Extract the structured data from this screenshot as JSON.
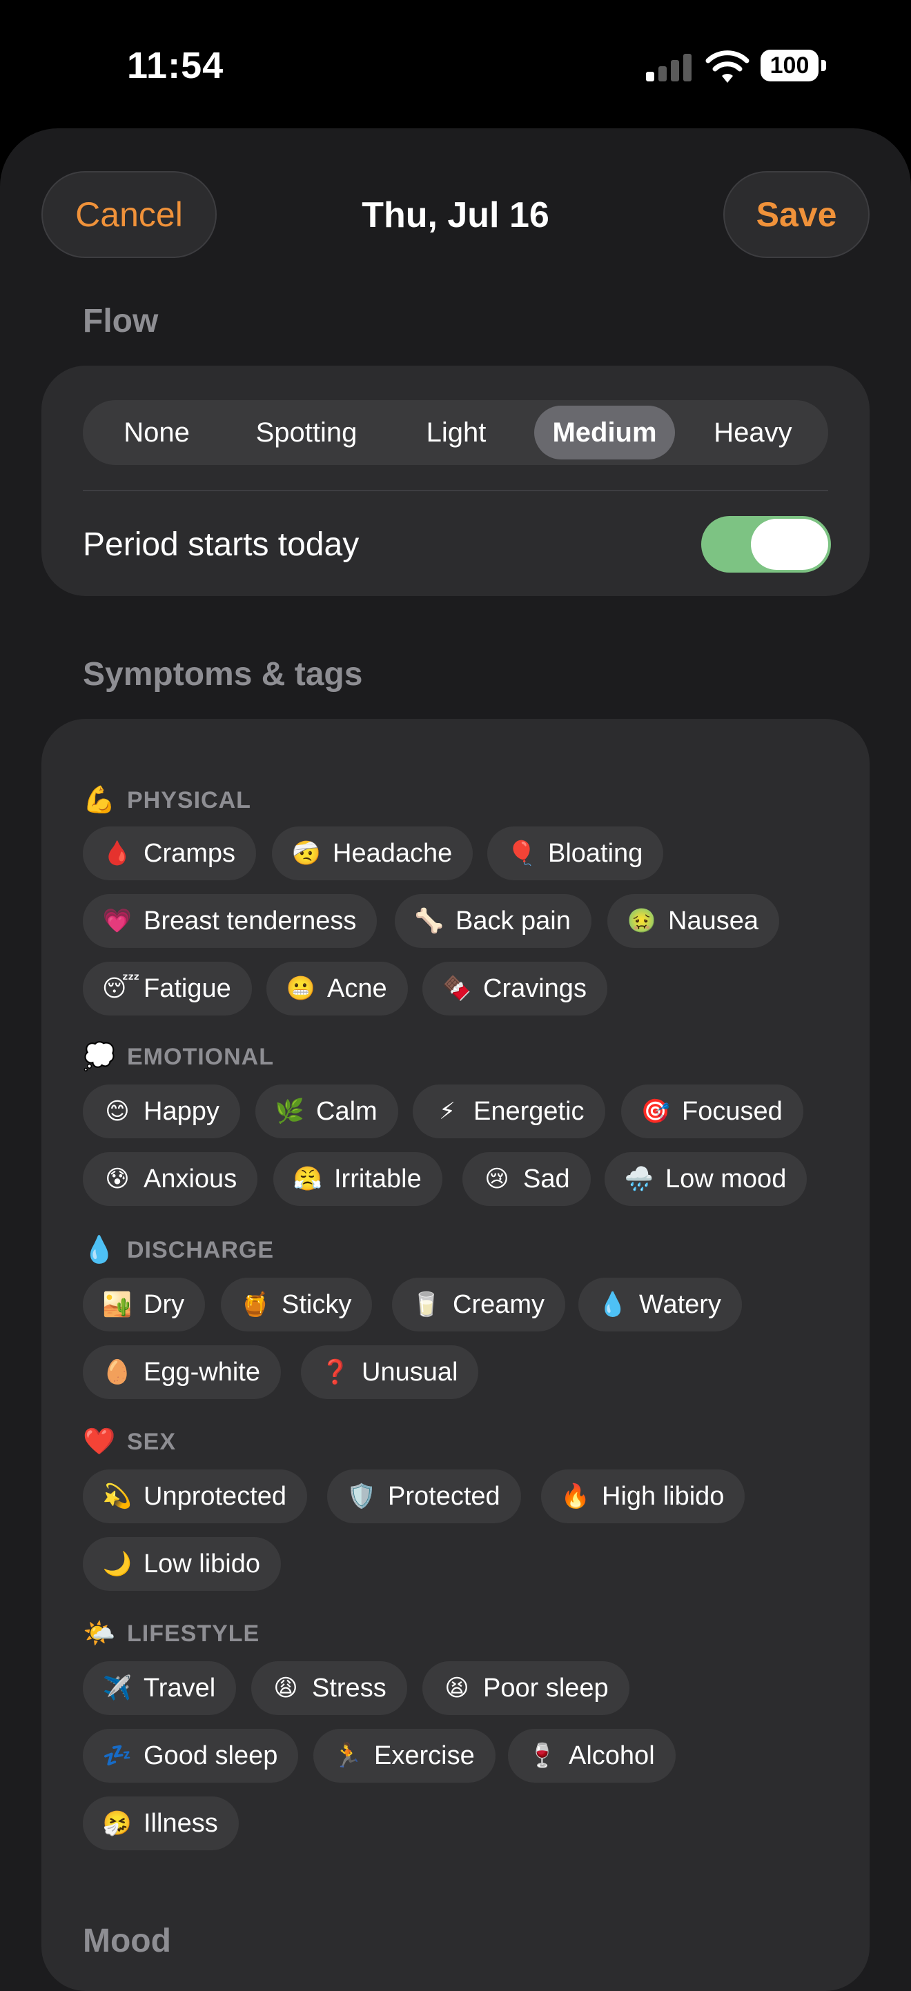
{
  "status": {
    "time": "11:54",
    "battery": "100"
  },
  "header": {
    "cancel_label": "Cancel",
    "title": "Thu, Jul 16",
    "save_label": "Save"
  },
  "flow": {
    "section_title": "Flow",
    "options": [
      "None",
      "Spotting",
      "Light",
      "Medium",
      "Heavy"
    ],
    "selected": "Medium",
    "toggle_label": "Period starts today",
    "toggle_on": true
  },
  "symptoms": {
    "section_title": "Symptoms & tags",
    "categories": [
      {
        "icon": "💪",
        "label": "PHYSICAL",
        "chips": [
          {
            "icon": "🩸",
            "label": "Cramps"
          },
          {
            "icon": "🤕",
            "label": "Headache"
          },
          {
            "icon": "🎈",
            "label": "Bloating"
          },
          {
            "icon": "💗",
            "label": "Breast tenderness"
          },
          {
            "icon": "🦴",
            "label": "Back pain"
          },
          {
            "icon": "🤢",
            "label": "Nausea"
          },
          {
            "icon": "😴",
            "label": "Fatigue"
          },
          {
            "icon": "😬",
            "label": "Acne"
          },
          {
            "icon": "🍫",
            "label": "Cravings"
          }
        ]
      },
      {
        "icon": "💭",
        "label": "EMOTIONAL",
        "chips": [
          {
            "icon": "😊",
            "label": "Happy"
          },
          {
            "icon": "🌿",
            "label": "Calm"
          },
          {
            "icon": "⚡",
            "label": "Energetic"
          },
          {
            "icon": "🎯",
            "label": "Focused"
          },
          {
            "icon": "😰",
            "label": "Anxious"
          },
          {
            "icon": "😤",
            "label": "Irritable"
          },
          {
            "icon": "😢",
            "label": "Sad"
          },
          {
            "icon": "🌧️",
            "label": "Low mood"
          }
        ]
      },
      {
        "icon": "💧",
        "label": "DISCHARGE",
        "chips": [
          {
            "icon": "🏜️",
            "label": "Dry"
          },
          {
            "icon": "🍯",
            "label": "Sticky"
          },
          {
            "icon": "🥛",
            "label": "Creamy"
          },
          {
            "icon": "💧",
            "label": "Watery"
          },
          {
            "icon": "🥚",
            "label": "Egg-white"
          },
          {
            "icon": "❓",
            "label": "Unusual"
          }
        ]
      },
      {
        "icon": "❤️",
        "label": "SEX",
        "chips": [
          {
            "icon": "💫",
            "label": "Unprotected"
          },
          {
            "icon": "🛡️",
            "label": "Protected"
          },
          {
            "icon": "🔥",
            "label": "High libido"
          },
          {
            "icon": "🌙",
            "label": "Low libido"
          }
        ]
      },
      {
        "icon": "🌤️",
        "label": "LIFESTYLE",
        "chips": [
          {
            "icon": "✈️",
            "label": "Travel"
          },
          {
            "icon": "😩",
            "label": "Stress"
          },
          {
            "icon": "😫",
            "label": "Poor sleep"
          },
          {
            "icon": "💤",
            "label": "Good sleep"
          },
          {
            "icon": "🏃",
            "label": "Exercise"
          },
          {
            "icon": "🍷",
            "label": "Alcohol"
          },
          {
            "icon": "🤧",
            "label": "Illness"
          }
        ]
      }
    ]
  },
  "mood": {
    "section_title": "Mood"
  }
}
